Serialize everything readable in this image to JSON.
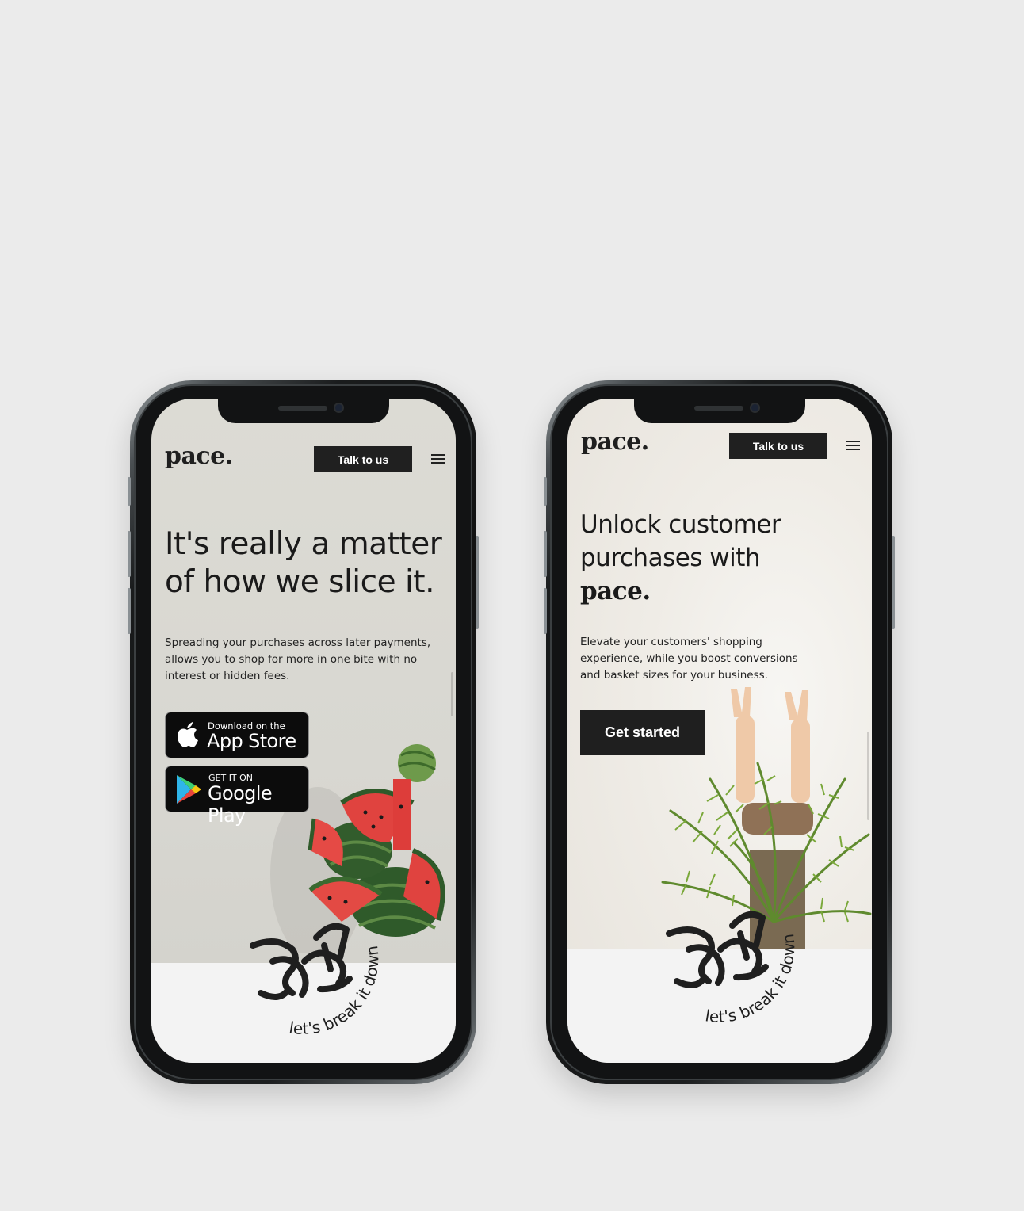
{
  "left_phone": {
    "logo": "pace.",
    "nav_cta": "Talk to us",
    "headline_line1": "It's really a matter",
    "headline_line2": "of how we slice it.",
    "body_line1": "Spreading your purchases across later payments,",
    "body_line2": "allows you to shop for more in one bite with no",
    "body_line3": "interest or hidden fees.",
    "app_store": {
      "small": "Download on the",
      "big": "App Store"
    },
    "google_play": {
      "small": "GET IT ON",
      "big": "Google Play"
    },
    "stamp_text": "let's break it down"
  },
  "right_phone": {
    "logo": "pace.",
    "nav_cta": "Talk to us",
    "headline_line1": "Unlock customer",
    "headline_line2": "purchases with",
    "headline_brand": "pace.",
    "body_line1": "Elevate your customers' shopping",
    "body_line2": "experience, while you boost conversions",
    "body_line3": "and basket sizes for your business.",
    "cta": "Get started",
    "stamp_text": "let's break it down"
  },
  "colors": {
    "page_bg": "#ebebeb",
    "button_dark": "#202020",
    "watermelon_red": "#e0433f",
    "watermelon_green": "#2f5a2a",
    "palm_green": "#5f8a2e"
  },
  "icons": [
    "menu-icon",
    "apple-icon",
    "google-play-icon"
  ]
}
